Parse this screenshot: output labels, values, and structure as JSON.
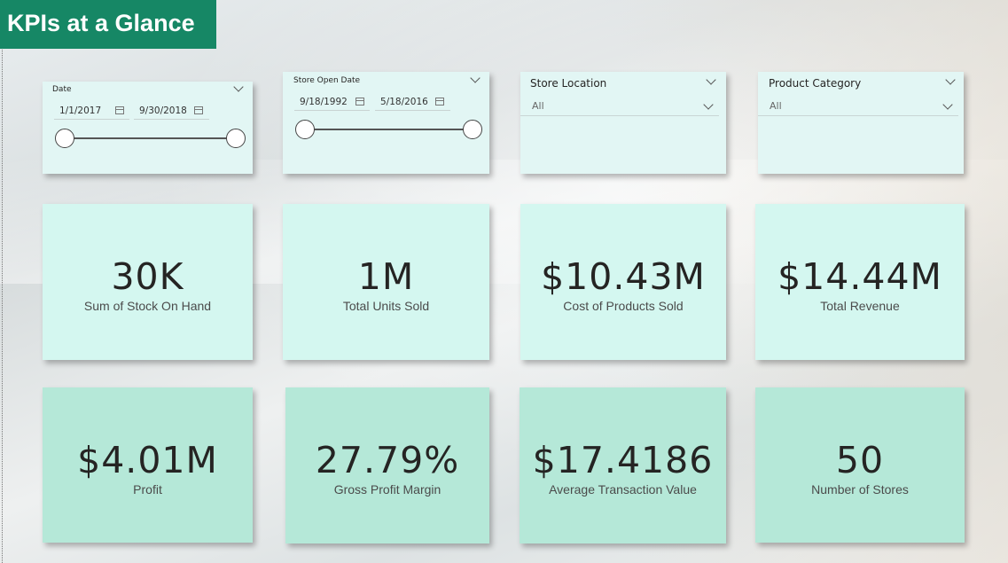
{
  "title": "KPIs at a Glance",
  "slicers": {
    "date": {
      "label": "Date",
      "start": "1/1/2017",
      "end": "9/30/2018"
    },
    "store_open_date": {
      "label": "Store Open Date",
      "start": "9/18/1992",
      "end": "5/18/2016"
    },
    "store_location": {
      "label": "Store Location",
      "selected": "All"
    },
    "product_category": {
      "label": "Product Category",
      "selected": "All"
    }
  },
  "kpis": [
    {
      "value": "30K",
      "label": "Sum of Stock On Hand"
    },
    {
      "value": "1M",
      "label": "Total Units Sold"
    },
    {
      "value": "$10.43M",
      "label": "Cost of Products Sold"
    },
    {
      "value": "$14.44M",
      "label": "Total Revenue"
    },
    {
      "value": "$4.01M",
      "label": "Profit"
    },
    {
      "value": "27.79%",
      "label": "Gross Profit Margin"
    },
    {
      "value": "$17.4186",
      "label": "Average Transaction Value"
    },
    {
      "value": "50",
      "label": "Number of Stores"
    }
  ],
  "colors": {
    "title_bg": "#168765",
    "slicer_bg": "#e2f6f4",
    "kpi_light": "#d4f7f0",
    "kpi_dark": "#b5e8d8"
  }
}
